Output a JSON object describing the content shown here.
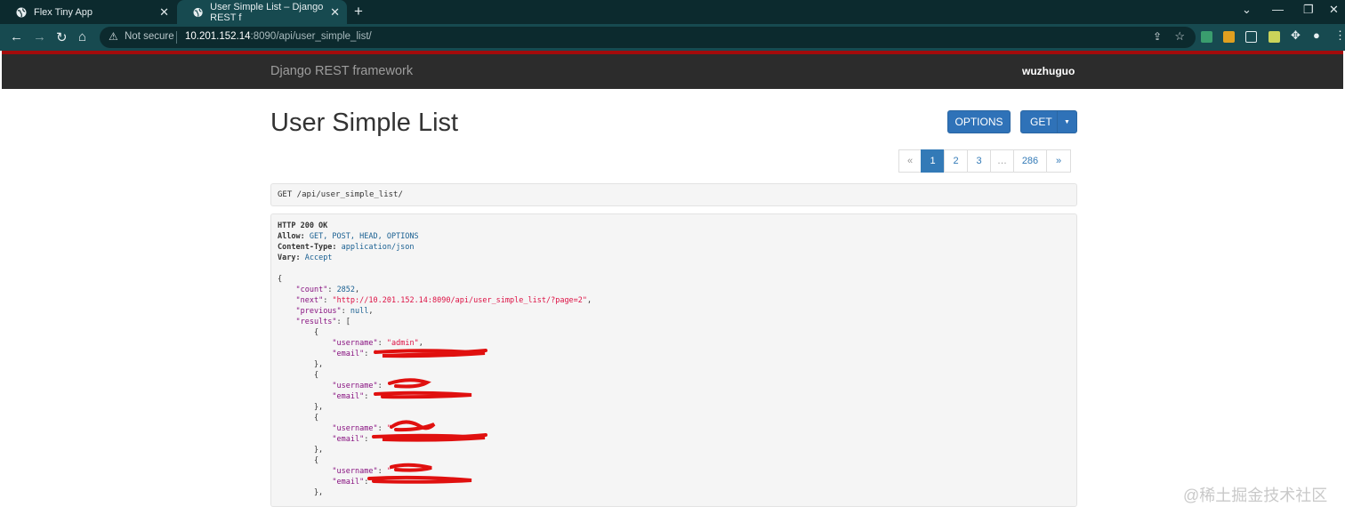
{
  "browser": {
    "tabs": [
      {
        "label": "Flex Tiny App"
      },
      {
        "label": "User Simple List – Django REST f"
      }
    ],
    "address": {
      "security": "Not secure",
      "host": "10.201.152.14",
      "path": ":8090/api/user_simple_list/"
    }
  },
  "navbar": {
    "brand": "Django REST framework",
    "user": "wuzhuguo"
  },
  "page": {
    "title": "User Simple List",
    "options_label": "OPTIONS",
    "get_label": "GET"
  },
  "pagination": [
    "«",
    "1",
    "2",
    "3",
    "…",
    "286",
    "»"
  ],
  "request": {
    "line": "GET /api/user_simple_list/"
  },
  "response": {
    "status": "HTTP 200 OK",
    "allow_label": "Allow:",
    "allow_value": "GET, POST, HEAD, OPTIONS",
    "ctype_label": "Content-Type:",
    "ctype_value": "application/json",
    "vary_label": "Vary:",
    "vary_value": "Accept",
    "count": "2852",
    "next": "\"http://10.201.152.14:8090/api/user_simple_list/?page=2\"",
    "previous": "null",
    "first_username": "\"admin\""
  },
  "watermark": "@稀土掘金技术社区",
  "colors": {
    "tab_bg": "#0c2a2e",
    "toolbar_bg": "#174a50",
    "navbar_bg": "#2c2c2c",
    "accent_red": "#a30b0b",
    "button_blue": "#2f72b8",
    "redaction": "#e0100f"
  }
}
